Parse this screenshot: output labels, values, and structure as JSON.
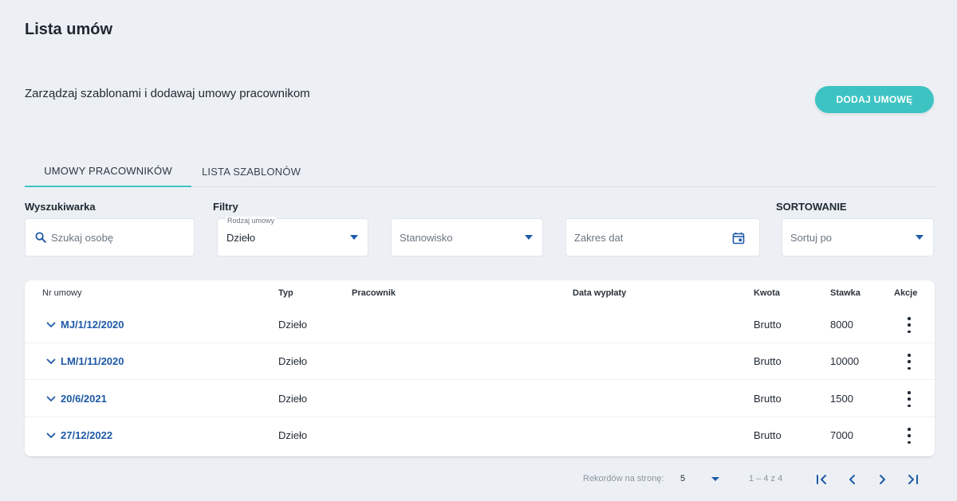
{
  "page": {
    "title": "Lista umów",
    "subtitle": "Zarządzaj szablonami i dodawaj umowy pracownikom",
    "add_button": "DODAJ UMOWĘ"
  },
  "tabs": [
    {
      "label": "UMOWY PRACOWNIKÓW",
      "active": true
    },
    {
      "label": "LISTA SZABLONÓW",
      "active": false
    }
  ],
  "filters": {
    "search_label": "Wyszukiwarka",
    "search_placeholder": "Szukaj osobę",
    "filters_label": "Filtry",
    "contract_type_label": "Rodzaj umowy",
    "contract_type_value": "Dzieło",
    "position_placeholder": "Stanowisko",
    "date_range_placeholder": "Zakres dat",
    "sort_label": "SORTOWANIE",
    "sort_placeholder": "Sortuj po"
  },
  "table": {
    "columns": {
      "nr": "Nr umowy",
      "typ": "Typ",
      "pracownik": "Pracownik",
      "data": "Data wypłaty",
      "kwota": "Kwota",
      "stawka": "Stawka",
      "akcje": "Akcje"
    },
    "rows": [
      {
        "nr": "MJ/1/12/2020",
        "typ": "Dzieło",
        "kwota": "Brutto",
        "stawka": "8000"
      },
      {
        "nr": "LM/1/11/2020",
        "typ": "Dzieło",
        "kwota": "Brutto",
        "stawka": "10000"
      },
      {
        "nr": "20/6/2021",
        "typ": "Dzieło",
        "kwota": "Brutto",
        "stawka": "1500"
      },
      {
        "nr": "27/12/2022",
        "typ": "Dzieło",
        "kwota": "Brutto",
        "stawka": "7000"
      }
    ]
  },
  "pagination": {
    "per_page_label": "Rekordów na stronę:",
    "per_page_value": "5",
    "range": "1 – 4 z 4"
  },
  "colors": {
    "accent": "#3ec3c3",
    "link": "#1e5aa8",
    "background": "#ecf0f4"
  },
  "icons": [
    "search-icon",
    "caret-down-icon",
    "calendar-icon",
    "chevron-down-icon",
    "kebab-menu-icon",
    "first-page-icon",
    "prev-page-icon",
    "next-page-icon",
    "last-page-icon"
  ]
}
